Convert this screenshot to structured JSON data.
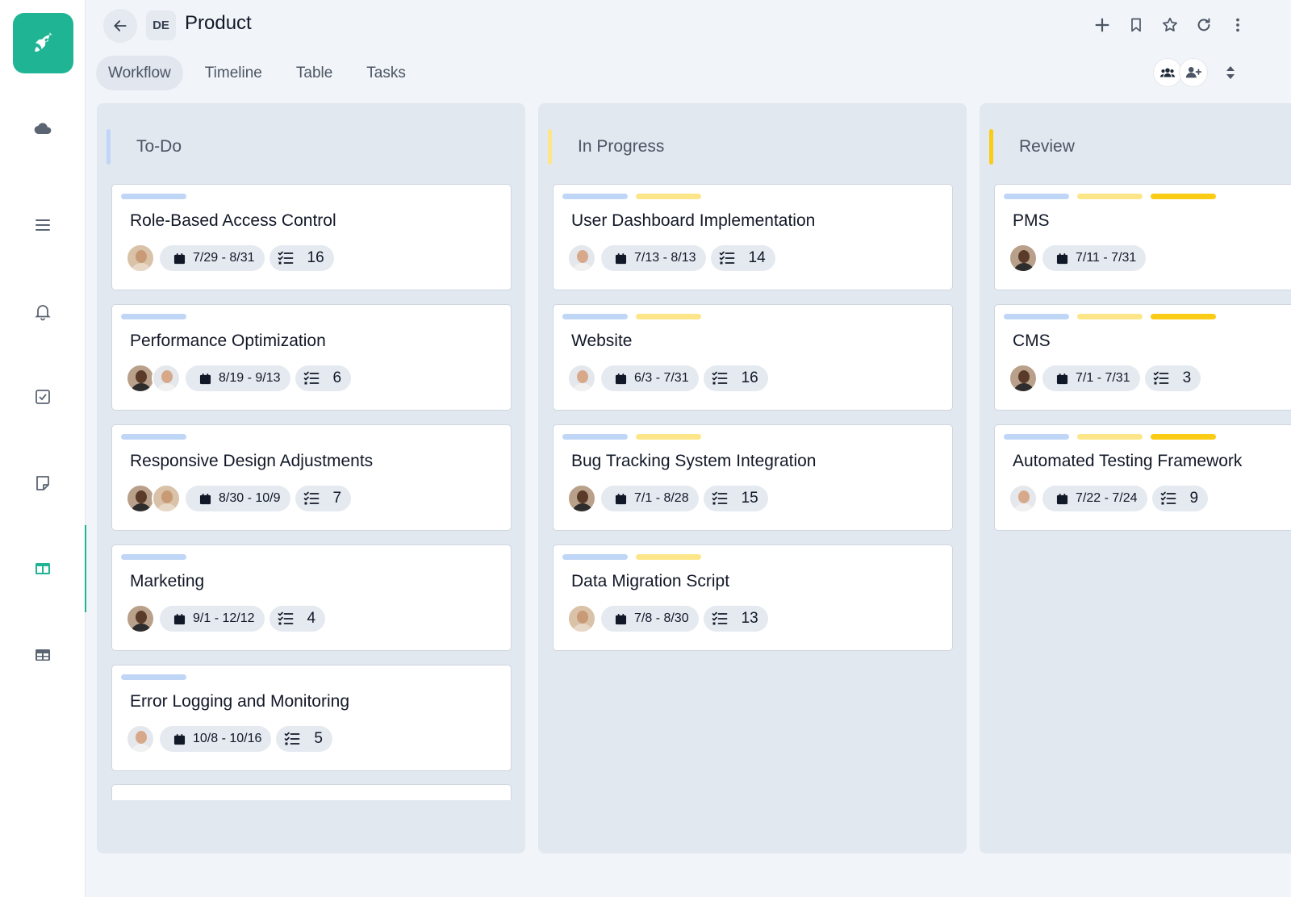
{
  "header": {
    "badge": "DE",
    "title": "Product",
    "tabs": [
      "Workflow",
      "Timeline",
      "Table",
      "Tasks"
    ],
    "active_tab": "Workflow"
  },
  "sidebar": {
    "items": [
      "cloud",
      "list",
      "notifications",
      "tasks",
      "notes",
      "board",
      "table"
    ],
    "active": "board",
    "accent": "#1fb594"
  },
  "board": {
    "columns": [
      {
        "title": "To-Do",
        "color": "#bfd6f6",
        "cards": [
          {
            "title": "Role-Based Access Control",
            "dates": "7/29 - 8/31",
            "count": "16",
            "avatars": [
              "woman"
            ],
            "tags": [
              "#bfd6f6"
            ]
          },
          {
            "title": "Performance Optimization",
            "dates": "8/19 - 9/13",
            "count": "6",
            "avatars": [
              "man-dark",
              "man"
            ],
            "tags": [
              "#bfd6f6"
            ]
          },
          {
            "title": "Responsive Design Adjustments",
            "dates": "8/30 - 10/9",
            "count": "7",
            "avatars": [
              "man-dark",
              "woman"
            ],
            "tags": [
              "#bfd6f6"
            ]
          },
          {
            "title": "Marketing",
            "dates": "9/1 - 12/12",
            "count": "4",
            "avatars": [
              "man-dark"
            ],
            "tags": [
              "#bfd6f6"
            ]
          },
          {
            "title": "Error Logging and Monitoring",
            "dates": "10/8 - 10/16",
            "count": "5",
            "avatars": [
              "man"
            ],
            "tags": [
              "#bfd6f6"
            ]
          }
        ]
      },
      {
        "title": "In Progress",
        "color": "#fde68a",
        "cards": [
          {
            "title": "User Dashboard Implementation",
            "dates": "7/13 - 8/13",
            "count": "14",
            "avatars": [
              "man"
            ],
            "tags": [
              "#bfd6f6",
              "#fde68a"
            ]
          },
          {
            "title": "Website",
            "dates": "6/3 - 7/31",
            "count": "16",
            "avatars": [
              "man"
            ],
            "tags": [
              "#bfd6f6",
              "#fde68a"
            ]
          },
          {
            "title": "Bug Tracking System Integration",
            "dates": "7/1 - 8/28",
            "count": "15",
            "avatars": [
              "man-dark"
            ],
            "tags": [
              "#bfd6f6",
              "#fde68a"
            ]
          },
          {
            "title": "Data Migration Script",
            "dates": "7/8 - 8/30",
            "count": "13",
            "avatars": [
              "woman"
            ],
            "tags": [
              "#bfd6f6",
              "#fde68a"
            ]
          }
        ]
      },
      {
        "title": "Review",
        "color": "#facc15",
        "cards": [
          {
            "title": "PMS",
            "dates": "7/11 - 7/31",
            "count": "",
            "avatars": [
              "man-dark"
            ],
            "tags": [
              "#bfd6f6",
              "#fde68a",
              "#facc15"
            ]
          },
          {
            "title": "CMS",
            "dates": "7/1 - 7/31",
            "count": "3",
            "avatars": [
              "man-dark"
            ],
            "tags": [
              "#bfd6f6",
              "#fde68a",
              "#facc15"
            ]
          },
          {
            "title": "Automated Testing Framework",
            "dates": "7/22 - 7/24",
            "count": "9",
            "avatars": [
              "man"
            ],
            "tags": [
              "#bfd6f6",
              "#fde68a",
              "#facc15"
            ]
          }
        ]
      }
    ]
  }
}
